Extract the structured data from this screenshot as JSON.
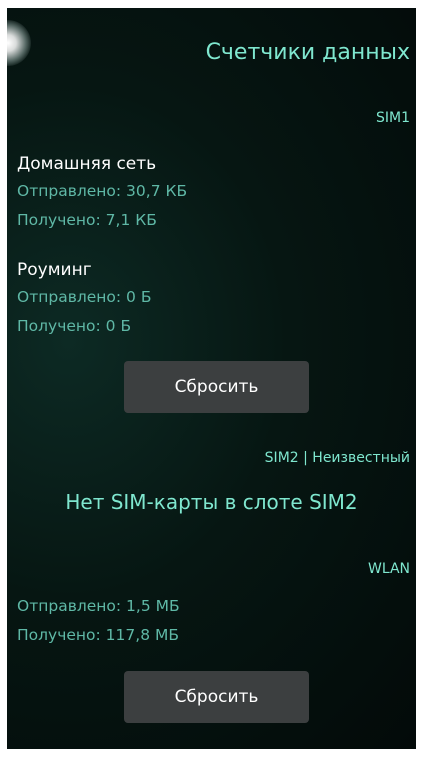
{
  "header": {
    "title": "Счетчики данных"
  },
  "sim1": {
    "label": "SIM1",
    "home": {
      "title": "Домашняя сеть",
      "sent": "Отправлено: 30,7 КБ",
      "received": "Получено: 7,1 КБ"
    },
    "roaming": {
      "title": "Роуминг",
      "sent": "Отправлено: 0 Б",
      "received": "Получено: 0 Б"
    },
    "reset_label": "Сбросить"
  },
  "sim2": {
    "label": "SIM2 | Неизвестный",
    "message": "Нет SIM-карты в слоте SIM2"
  },
  "wlan": {
    "label": "WLAN",
    "sent": "Отправлено: 1,5 МБ",
    "received": "Получено: 117,8 МБ",
    "reset_label": "Сбросить"
  },
  "colors": {
    "accent": "#7fe7cf",
    "secondary_text": "#5fb8a6",
    "button_bg": "#3c3f40",
    "background": "#061612"
  }
}
